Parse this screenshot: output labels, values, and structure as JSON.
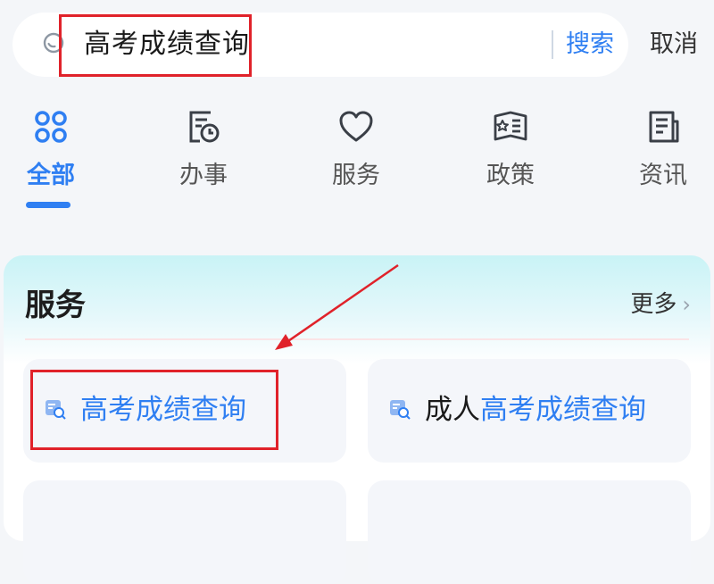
{
  "search": {
    "value": "高考成绩查询",
    "search_label": "搜索",
    "cancel_label": "取消"
  },
  "tabs": [
    {
      "label": "全部",
      "icon": "grid-icon",
      "active": true
    },
    {
      "label": "办事",
      "icon": "task-clock-icon",
      "active": false
    },
    {
      "label": "服务",
      "icon": "heart-icon",
      "active": false
    },
    {
      "label": "政策",
      "icon": "policy-book-icon",
      "active": false
    },
    {
      "label": "资讯",
      "icon": "news-document-icon",
      "active": false
    }
  ],
  "services": {
    "title": "服务",
    "more_label": "更多",
    "items": [
      {
        "icon": "service-search-icon",
        "prefix": "",
        "match": "高考成绩查询"
      },
      {
        "icon": "service-search-icon",
        "prefix": "成人",
        "match": "高考成绩查询"
      }
    ]
  },
  "colors": {
    "accent": "#2f7ff2",
    "highlight": "#e0222a"
  }
}
